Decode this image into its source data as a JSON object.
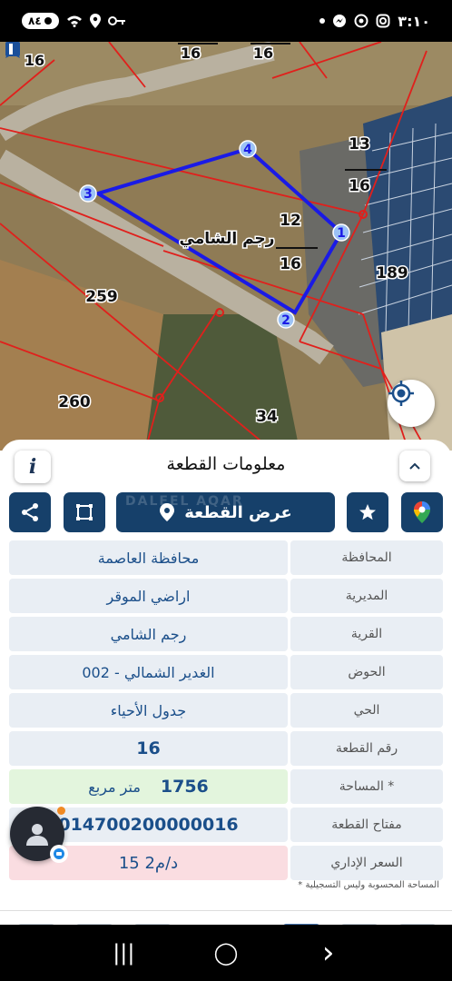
{
  "status_bar": {
    "time": "٣:١٠",
    "battery": "٨٤",
    "icons": [
      "signal-icon",
      "wifi-icon",
      "location-icon",
      "key-icon",
      "messenger-icon",
      "chatgpt-icon",
      "instagram-icon",
      "dot-icon"
    ]
  },
  "map": {
    "polygon_label": "رجم الشامي",
    "vertex_labels": [
      "1",
      "2",
      "3",
      "4"
    ],
    "parcel_numbers": {
      "top_left": "16",
      "top_center": "16",
      "top_center2": "16",
      "n13": "13",
      "n13_den": "16",
      "n12": "12",
      "n12_den": "16",
      "n189": "189",
      "n259": "259",
      "n260": "260",
      "n34": "34"
    }
  },
  "panel": {
    "title": "معلومات القطعة",
    "info_label": "i",
    "show_parcel_label": "عرض القطعة",
    "watermark": "DALEEL AQAR",
    "rows": [
      {
        "label": "المحافظة",
        "value": "محافظة العاصمة"
      },
      {
        "label": "المديرية",
        "value": "اراضي الموقر"
      },
      {
        "label": "القرية",
        "value": "رجم الشامي"
      },
      {
        "label": "الحوض",
        "value": "الغدير الشمالي - 002"
      },
      {
        "label": "الحي",
        "value": "جدول الأحياء"
      },
      {
        "label": "رقم القطعة",
        "value": "16"
      },
      {
        "label": "المساحة *",
        "value_number": "1756",
        "value_unit": "متر مربع"
      },
      {
        "label": "مفتاح القطعة",
        "value": "014700200000016"
      },
      {
        "label": "السعر الإداري",
        "value": "15 د/م2"
      }
    ],
    "note": "* المساحة المحسوبة وليس التسجيلية"
  },
  "colors": {
    "primary": "#16406a",
    "value_text": "#1b4f8a",
    "row_bg": "#e9eef4",
    "area_bg": "#e3f5dd",
    "price_bg": "#fadde1",
    "polygon": "#1a1ae6",
    "parcel_lines": "#e0201c"
  },
  "nav": {
    "recents": "|||",
    "home": "◯",
    "back": "›"
  }
}
